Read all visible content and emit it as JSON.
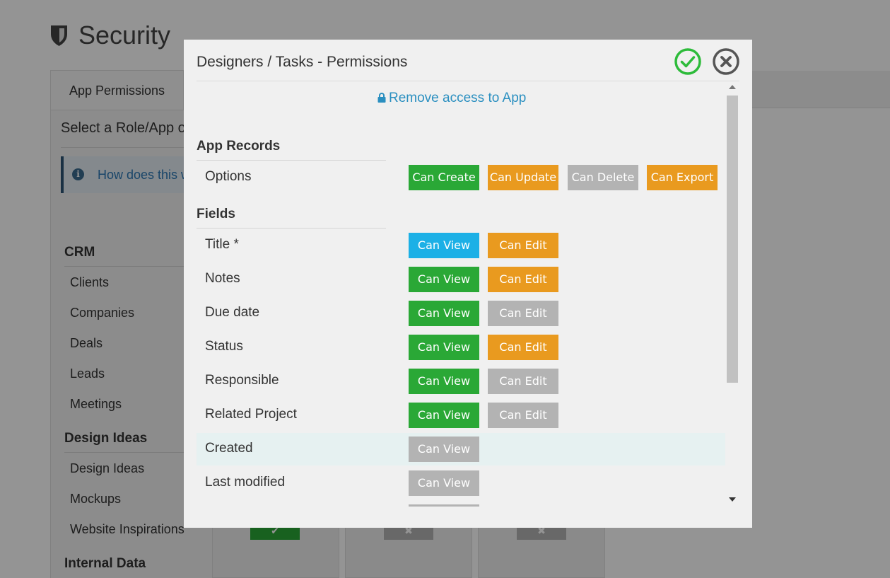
{
  "page": {
    "title": "Security"
  },
  "sidebar": {
    "tab_label": "App Permissions",
    "select_text": "Select a Role/App o",
    "info_text": "How does this w",
    "groups": [
      {
        "label": "CRM",
        "items": [
          "Clients",
          "Companies",
          "Deals",
          "Leads",
          "Meetings"
        ]
      },
      {
        "label": "Design Ideas",
        "items": [
          "Design Ideas",
          "Mockups",
          "Website Inspirations"
        ]
      },
      {
        "label": "Internal Data",
        "items": []
      }
    ]
  },
  "modal": {
    "title": "Designers / Tasks - Permissions",
    "remove_access_label": "Remove access to App",
    "app_records": {
      "header": "App Records",
      "row_label": "Options",
      "buttons": [
        {
          "label": "Can Create",
          "state": "green"
        },
        {
          "label": "Can Update",
          "state": "orange"
        },
        {
          "label": "Can Delete",
          "state": "gray"
        },
        {
          "label": "Can Export",
          "state": "orange"
        }
      ]
    },
    "fields": {
      "header": "Fields",
      "rows": [
        {
          "label": "Title *",
          "view": {
            "label": "Can View",
            "state": "blue"
          },
          "edit": {
            "label": "Can Edit",
            "state": "orange"
          }
        },
        {
          "label": "Notes",
          "view": {
            "label": "Can View",
            "state": "green"
          },
          "edit": {
            "label": "Can Edit",
            "state": "orange"
          }
        },
        {
          "label": "Due date",
          "view": {
            "label": "Can View",
            "state": "green"
          },
          "edit": {
            "label": "Can Edit",
            "state": "gray"
          }
        },
        {
          "label": "Status",
          "view": {
            "label": "Can View",
            "state": "green"
          },
          "edit": {
            "label": "Can Edit",
            "state": "orange"
          }
        },
        {
          "label": "Responsible",
          "view": {
            "label": "Can View",
            "state": "green"
          },
          "edit": {
            "label": "Can Edit",
            "state": "gray"
          }
        },
        {
          "label": "Related Project",
          "view": {
            "label": "Can View",
            "state": "green"
          },
          "edit": {
            "label": "Can Edit",
            "state": "gray"
          }
        },
        {
          "label": "Created",
          "view": {
            "label": "Can View",
            "state": "gray"
          }
        },
        {
          "label": "Last modified",
          "view": {
            "label": "Can View",
            "state": "gray"
          }
        }
      ]
    }
  },
  "colors": {
    "green": "#2aa836",
    "orange": "#e99a1f",
    "gray": "#b3b3b3",
    "blue": "#1cb0e6",
    "ok_icon": "#2dbb3a",
    "close_icon": "#555555",
    "link": "#2a8fc0"
  },
  "icons": {
    "page_title_icon": "shield-icon",
    "ok_icon": "check-circle-icon",
    "close_icon": "close-circle-icon",
    "remove_access_icon": "lock-icon",
    "info_icon": "info-icon"
  }
}
